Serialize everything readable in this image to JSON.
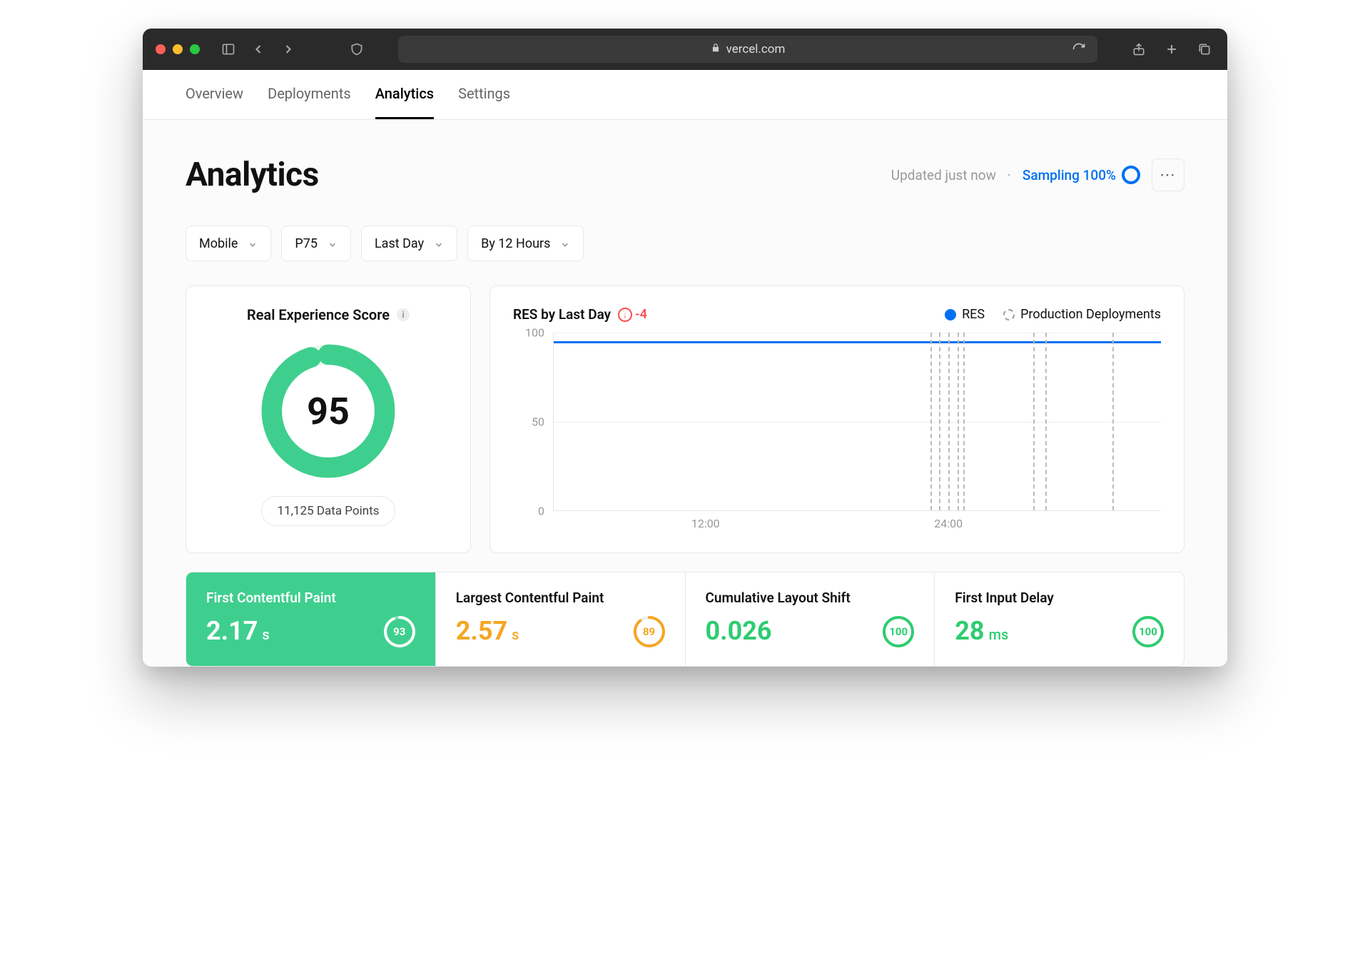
{
  "browser": {
    "url_host": "vercel.com"
  },
  "tabs": [
    "Overview",
    "Deployments",
    "Analytics",
    "Settings"
  ],
  "tabs_active_index": 2,
  "page_title": "Analytics",
  "header": {
    "updated_text": "Updated just now",
    "sampling_text": "Sampling 100%"
  },
  "filters": {
    "device": "Mobile",
    "percentile": "P75",
    "range": "Last Day",
    "group_by": "By 12 Hours"
  },
  "score_card": {
    "title": "Real Experience Score",
    "value": 95,
    "data_points_label": "11,125 Data Points"
  },
  "chart": {
    "title": "RES by Last Day",
    "delta": -4,
    "legend": {
      "series": "RES",
      "markers": "Production Deployments"
    }
  },
  "chart_data": {
    "type": "line",
    "title": "RES by Last Day",
    "ylabel": "",
    "ylim": [
      0,
      100
    ],
    "y_ticks": [
      0,
      50,
      100
    ],
    "x_ticks": [
      "12:00",
      "24:00"
    ],
    "x_tick_positions_pct": [
      25,
      65
    ],
    "series": [
      {
        "name": "RES",
        "color": "#0070f3",
        "approx_const_value": 95
      }
    ],
    "deployment_markers_pct": [
      62,
      63.5,
      65,
      66.5,
      67.5,
      79,
      81,
      92
    ]
  },
  "metrics": [
    {
      "key": "fcp",
      "name": "First Contentful Paint",
      "value": "2.17",
      "unit": "s",
      "score": 93,
      "color": "white",
      "ring": "#ffffff",
      "active": true
    },
    {
      "key": "lcp",
      "name": "Largest Contentful Paint",
      "value": "2.57",
      "unit": "s",
      "score": 89,
      "color": "orange",
      "ring": "#f5a623",
      "active": false
    },
    {
      "key": "cls",
      "name": "Cumulative Layout Shift",
      "value": "0.026",
      "unit": "",
      "score": 100,
      "color": "green",
      "ring": "#2ecc71",
      "active": false
    },
    {
      "key": "fid",
      "name": "First Input Delay",
      "value": "28",
      "unit": "ms",
      "score": 100,
      "color": "green",
      "ring": "#2ecc71",
      "active": false
    }
  ]
}
